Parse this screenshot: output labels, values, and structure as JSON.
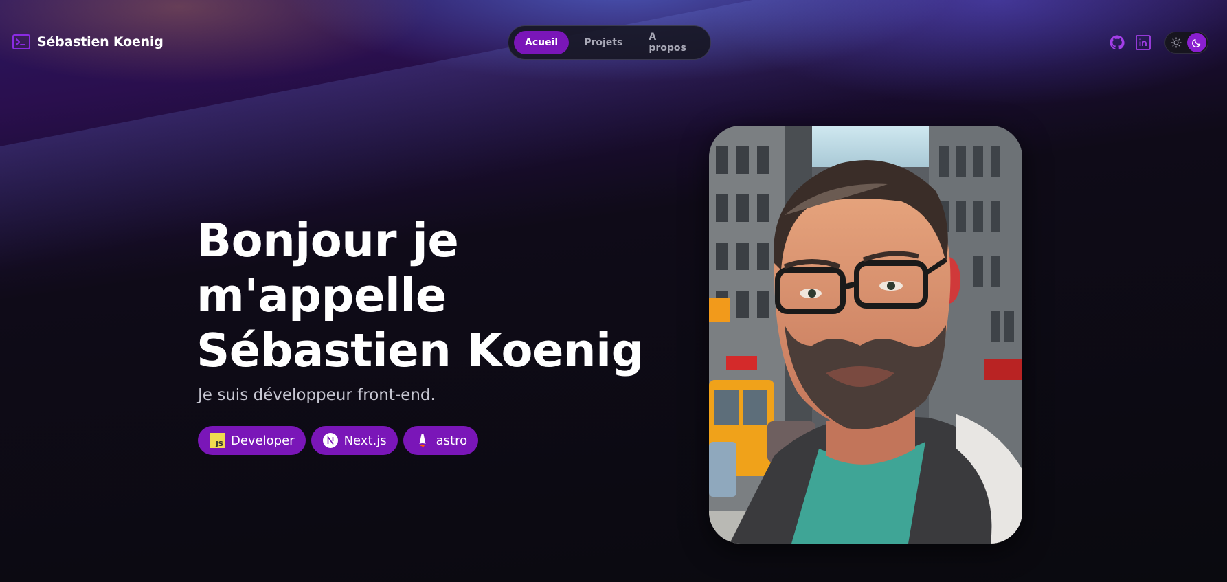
{
  "header": {
    "logo_icon": "terminal-icon",
    "site_name": "Sébastien Koenig"
  },
  "nav": {
    "items": [
      {
        "label": "Acueil",
        "active": true
      },
      {
        "label": "Projets",
        "active": false
      },
      {
        "label": "A propos",
        "active": false
      }
    ]
  },
  "social": {
    "icons": [
      "github-icon",
      "linkedin-icon"
    ]
  },
  "theme_toggle": {
    "icons": [
      "sun-icon",
      "moon-icon"
    ],
    "mode": "dark"
  },
  "hero": {
    "title_lines": [
      "Bonjour je",
      "m'appelle",
      "Sébastien Koenig"
    ],
    "subtitle": "Je suis développeur front-end.",
    "tags": [
      {
        "label": "Developer",
        "icon": "javascript-icon"
      },
      {
        "label": "Next.js",
        "icon": "nextjs-icon"
      },
      {
        "label": "astro",
        "icon": "astro-icon"
      }
    ]
  },
  "colors": {
    "accent": "#7a16b8",
    "background": "#0b0a10",
    "text": "#ffffff",
    "muted_text": "#c7c7d2"
  }
}
